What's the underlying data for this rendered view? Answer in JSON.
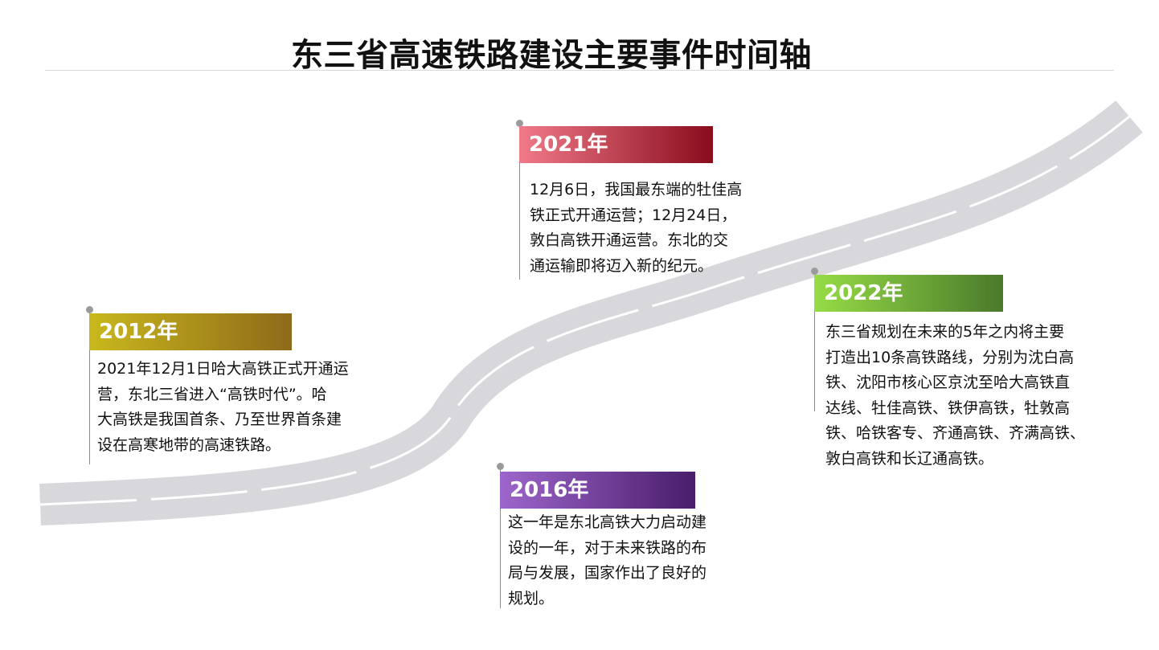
{
  "title": "东三省高速铁路建设主要事件时间轴",
  "colors": {
    "road": "#d8d7dc",
    "road_lane": "#ffffff",
    "marker": "#9a9a9a"
  },
  "events": [
    {
      "year": "2012年",
      "gradient": [
        "#c9b81c",
        "#8e6a1a"
      ],
      "lines": [
        "2021年12月1日哈大高铁正式开通运",
        "营，东北三省进入“高铁时代”。哈",
        "大高铁是我国首条、乃至世界首条建",
        "设在高寒地带的高速铁路。"
      ]
    },
    {
      "year": "2016年",
      "gradient": [
        "#9d66cc",
        "#4a1d6a"
      ],
      "lines": [
        "这一年是东北高铁大力启动建",
        "设的一年，对于未来铁路的布",
        "局与发展，国家作出了良好的",
        "规划。"
      ]
    },
    {
      "year": "2021年",
      "gradient": [
        "#f07a88",
        "#8a0c1c"
      ],
      "lines": [
        "12月6日，我国最东端的牡佳高",
        "铁正式开通运营；12月24日，",
        "敦白高铁开通运营。东北的交",
        "通运输即将迈入新的纪元。"
      ]
    },
    {
      "year": "2022年",
      "gradient": [
        "#96dc46",
        "#4a7a2c"
      ],
      "lines": [
        "东三省规划在未来的5年之内将主要",
        "打造出10条高铁路线，分别为沈白高",
        "铁、沈阳市核心区京沈至哈大高铁直",
        "达线、牡佳高铁、铁伊高铁，牡敦高",
        "铁、哈铁客专、齐通高铁、齐满高铁、",
        "敦白高铁和长辽通高铁。"
      ]
    }
  ]
}
